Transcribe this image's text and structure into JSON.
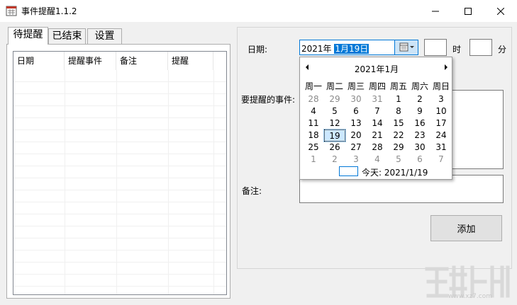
{
  "window": {
    "title": "事件提醒1.1.2",
    "controls": {
      "minimize": "minimize-icon",
      "maximize": "maximize-icon",
      "close": "close-icon"
    }
  },
  "tabs": [
    {
      "label": "待提醒",
      "active": true
    },
    {
      "label": "已结束",
      "active": false
    },
    {
      "label": "设置",
      "active": false
    }
  ],
  "list": {
    "columns": [
      "日期",
      "提醒事件",
      "备注",
      "提醒"
    ]
  },
  "form": {
    "date_label": "日期:",
    "date_year": "2021年",
    "date_month_day": "1月19日",
    "hour_label": "时",
    "hour_value": "",
    "minute_label": "分",
    "minute_value": "",
    "event_label": "要提醒的事件:",
    "event_value": "",
    "note_label": "备注:",
    "note_value": "",
    "add_button": "添加"
  },
  "calendar": {
    "month_title": "2021年1月",
    "weekdays": [
      "周一",
      "周二",
      "周三",
      "周四",
      "周五",
      "周六",
      "周日"
    ],
    "weeks": [
      [
        "28",
        "29",
        "30",
        "31",
        "1",
        "2",
        "3"
      ],
      [
        "4",
        "5",
        "6",
        "7",
        "8",
        "9",
        "10"
      ],
      [
        "11",
        "12",
        "13",
        "14",
        "15",
        "16",
        "17"
      ],
      [
        "18",
        "19",
        "20",
        "21",
        "22",
        "23",
        "24"
      ],
      [
        "25",
        "26",
        "27",
        "28",
        "29",
        "30",
        "31"
      ],
      [
        "1",
        "2",
        "3",
        "4",
        "5",
        "6",
        "7"
      ]
    ],
    "selected": "19",
    "today_label": "今天: 2021/1/19"
  },
  "watermark": {
    "url": "www.xz7.com"
  },
  "colors": {
    "accent": "#0078d7",
    "selected_day_bg": "#cce8ff",
    "other_month_text": "#8a8a8a"
  }
}
